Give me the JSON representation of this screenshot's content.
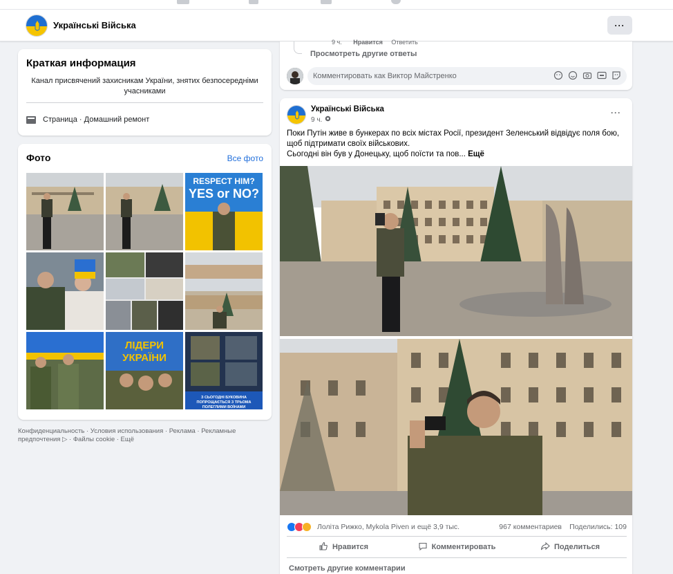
{
  "page": {
    "name": "Українські Війська",
    "more_label": "···"
  },
  "about": {
    "title": "Краткая информация",
    "description": "Канал присвячений захисникам України, знятих безпосередніми учасниками",
    "page_info": "Страница · Домашний ремонт"
  },
  "photos": {
    "title": "Фото",
    "all_link": "Все фото",
    "items": [
      {
        "label": ""
      },
      {
        "label": ""
      },
      {
        "label": "RESPECT HIM? YES or NO?"
      },
      {
        "label": ""
      },
      {
        "label": ""
      },
      {
        "label": ""
      },
      {
        "label": ""
      },
      {
        "label": "ЛІДЕРИ УКРАЇНИ"
      },
      {
        "label": "З СЬОГОДНІ БУКОВИНА ПОПРОЩАЄТЬСЯ З ТРЬОМА ПОЛЕГЛИМИ ВОЇНАМИ"
      }
    ]
  },
  "footer": {
    "links": "Конфиденциальность · Условия использования · Реклама · Рекламные предпочтения ▷ · Файлы cookie · Ещё"
  },
  "previous_comment": {
    "time": "9 ч.",
    "like": "Нравится",
    "reply": "Ответить",
    "view_more": "Просмотреть другие ответы",
    "input_placeholder": "Комментировать как Виктор Майстренко"
  },
  "post": {
    "author": "Українські Війська",
    "time": "9 ч.",
    "text_line1": "Поки Путін живе в бункерах по всіх містах Росії, президент Зеленський відвідує поля бою, щоб підтримати своїх військових.",
    "text_line2": "Сьогодні він був у Донецьку, щоб поїсти та пов...",
    "more_link": "Ещё",
    "reactions_names": "Лоліта Рижко, Mykola Piven и ещё 3,9 тыс.",
    "comments_count": "967 комментариев",
    "shares_count": "Поделились: 109",
    "like_label": "Нравится",
    "comment_label": "Комментировать",
    "share_label": "Поделиться",
    "view_more_comments": "Смотреть другие комментарии"
  },
  "colors": {
    "link": "#216fdb",
    "accent_blue": "#1877f2",
    "background": "#f0f2f5"
  }
}
